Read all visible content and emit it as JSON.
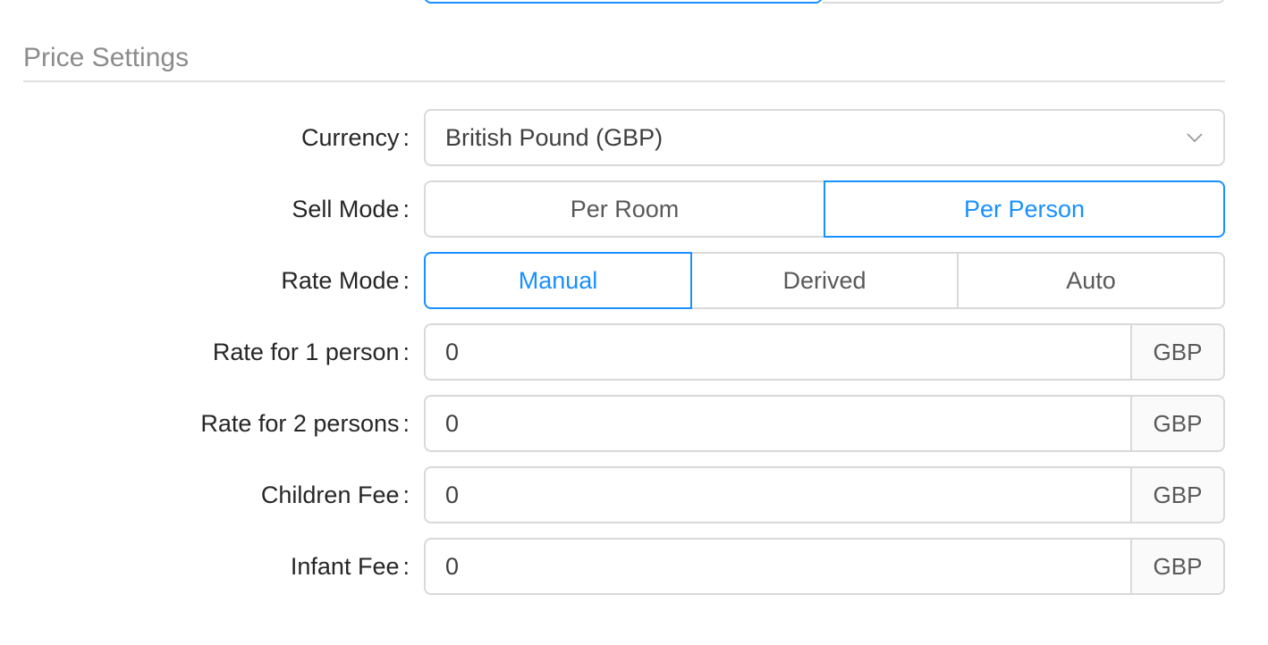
{
  "section": {
    "title": "Price Settings"
  },
  "currency": {
    "label": "Currency",
    "value": "British Pound (GBP)",
    "icon": "chevron-down-icon"
  },
  "sell_mode": {
    "label": "Sell Mode",
    "options": [
      "Per Room",
      "Per Person"
    ],
    "selected": "Per Person"
  },
  "rate_mode": {
    "label": "Rate Mode",
    "options": [
      "Manual",
      "Derived",
      "Auto"
    ],
    "selected": "Manual"
  },
  "fields": [
    {
      "label": "Rate for 1 person",
      "value": "0",
      "unit": "GBP"
    },
    {
      "label": "Rate for 2 persons",
      "value": "0",
      "unit": "GBP"
    },
    {
      "label": "Children Fee",
      "value": "0",
      "unit": "GBP"
    },
    {
      "label": "Infant Fee",
      "value": "0",
      "unit": "GBP"
    }
  ],
  "colors": {
    "accent": "#1890ff",
    "border": "#d9d9d9",
    "section_title": "#8c8c8c"
  }
}
